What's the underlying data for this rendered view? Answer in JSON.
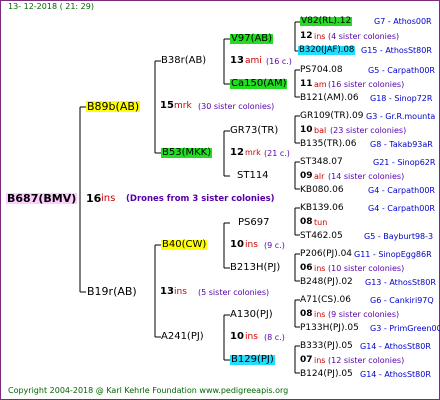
{
  "timestamp": "13- 12-2018 ( 21: 29)",
  "colors": {
    "green": "#22dd22",
    "yellow": "#ffff00",
    "cyan": "#22ddff",
    "root_bg": "#ffccff"
  },
  "root": {
    "label": "B687(BMV)",
    "count": "16",
    "ins": "ins",
    "note": "(Drones from 3 sister colonies)"
  },
  "g1": {
    "upper": {
      "label": "B89b(AB)",
      "count": "15",
      "ins": "mrk",
      "note": "(30 sister colonies)"
    },
    "lower": {
      "label": "B19r(AB)",
      "count": "13",
      "ins": "ins",
      "note": "(5 sister colonies)"
    }
  },
  "g2": {
    "a": {
      "label": "B38r(AB)",
      "count": "13",
      "ins": "ami",
      "note": "(16 c.)"
    },
    "b": {
      "label": "B53(MKK)",
      "count": "12",
      "ins": "mrk",
      "note": "(21 c.)"
    },
    "c": {
      "label": "B40(CW)",
      "count": "10",
      "ins": "ins",
      "note": "(9 c.)"
    },
    "d": {
      "label": "A241(PJ)",
      "count": "10",
      "ins": "ins",
      "note": "(8 c.)"
    }
  },
  "g3": {
    "a1": "V97(AB)",
    "a2": "Ca150(AM)",
    "b1": "GR73(TR)",
    "b2": "ST114",
    "c1": "PS697",
    "c2": "B213H(PJ)",
    "d1": "A130(PJ)",
    "d2": "B129(PJ)"
  },
  "g4": [
    {
      "top": "V82(RL).12",
      "topr": "G7 - Athos00R",
      "count": "12",
      "ins": "ins",
      "note": "(4 sister colonies)",
      "bot": "B320(JAF).08",
      "botr": "G15 - AthosSt80R"
    },
    {
      "top": "PS704.08",
      "topr": "G5 - Carpath00R",
      "count": "11",
      "ins": "am",
      "note": "(16 sister colonies)",
      "bot": "B121(AM).06",
      "botr": "G18 - Sinop72R"
    },
    {
      "top": "GR109(TR).09",
      "topr": "G3 - Gr.R.mounta",
      "count": "10",
      "ins": "bal",
      "note": "(23 sister colonies)",
      "bot": "B135(TR).06",
      "botr": "G8 - Takab93aR"
    },
    {
      "top": "ST348.07",
      "topr": "G21 - Sinop62R",
      "count": "09",
      "ins": "alr",
      "note": "(14 sister colonies)",
      "bot": "KB080.06",
      "botr": "G4 - Carpath00R"
    },
    {
      "top": "KB139.06",
      "topr": "G4 - Carpath00R",
      "count": "08",
      "ins": "tun",
      "note": "",
      "bot": "ST462.05",
      "botr": "G5 - Bayburt98-3"
    },
    {
      "top": "P206(PJ).04",
      "topr": "G11 - SinopEgg86R",
      "count": "06",
      "ins": "ins",
      "note": "(10 sister colonies)",
      "bot": "B248(PJ).02",
      "botr": "G13 - AthosSt80R"
    },
    {
      "top": "A71(CS).06",
      "topr": "G6 - Cankiri97Q",
      "count": "08",
      "ins": "ins",
      "note": "(9 sister colonies)",
      "bot": "P133H(PJ).05",
      "botr": "G3 - PrimGreen00"
    },
    {
      "top": "B333(PJ).05",
      "topr": "G14 - AthosSt80R",
      "count": "07",
      "ins": "ins",
      "note": "(12 sister colonies)",
      "bot": "B124(PJ).05",
      "botr": "G14 - AthosSt80R"
    }
  ],
  "copyright": "Copyright 2004-2018 @ Karl Kehrle Foundation    www.pedigreeapis.org"
}
